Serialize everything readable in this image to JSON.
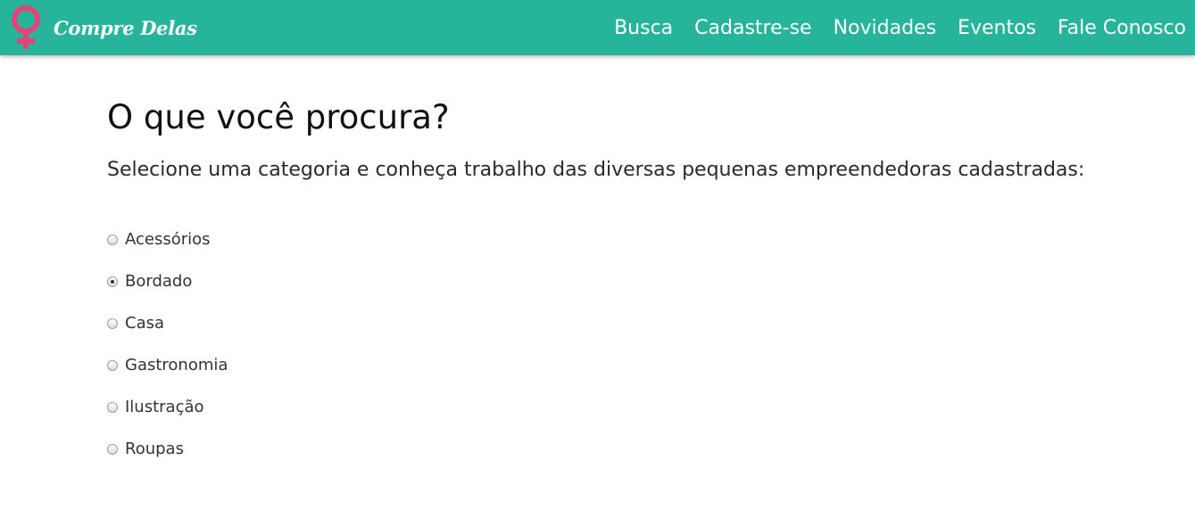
{
  "navbar": {
    "brand_name": "Compre Delas",
    "brand_color": "#26b59b",
    "logo_icon": "venus-symbol-icon",
    "logo_color": "#e5427a",
    "links": [
      "Busca",
      "Cadastre-se",
      "Novidades",
      "Eventos",
      "Fale Conosco"
    ]
  },
  "main": {
    "title": "O que você procura?",
    "subtitle": "Selecione uma categoria e conheça trabalho das diversas pequenas empreendedoras cadastradas:",
    "categories": [
      {
        "label": "Acessórios",
        "checked": false
      },
      {
        "label": "Bordado",
        "checked": true
      },
      {
        "label": "Casa",
        "checked": false
      },
      {
        "label": "Gastronomia",
        "checked": false
      },
      {
        "label": "Ilustração",
        "checked": false
      },
      {
        "label": "Roupas",
        "checked": false
      }
    ]
  }
}
